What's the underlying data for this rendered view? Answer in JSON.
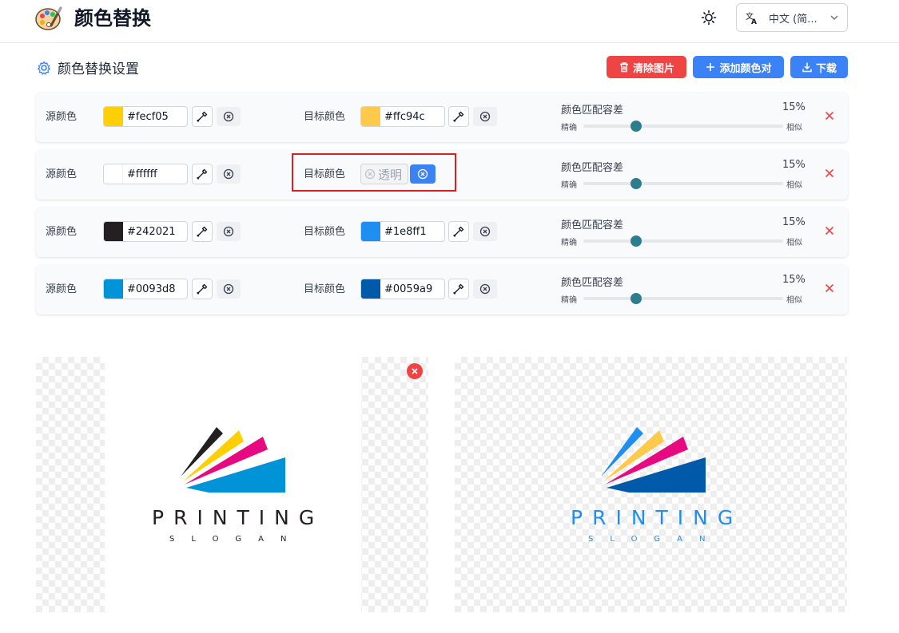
{
  "app": {
    "title": "颜色替换",
    "language": "中文 (简..."
  },
  "settings": {
    "title": "颜色替换设置",
    "clear_label": "清除图片",
    "add_label": "添加颜色对",
    "download_label": "下载"
  },
  "labels": {
    "source": "源颜色",
    "target": "目标颜色",
    "tolerance": "颜色匹配容差",
    "precise": "精确",
    "similar": "相似",
    "transparent": "透明"
  },
  "rows": [
    {
      "source_hex": "#fecf05",
      "target_hex": "#ffc94c",
      "target_transparent": false,
      "tolerance_text": "15%",
      "tolerance": 15
    },
    {
      "source_hex": "#ffffff",
      "target_hex": "",
      "target_transparent": true,
      "tolerance_text": "15%",
      "tolerance": 15
    },
    {
      "source_hex": "#242021",
      "target_hex": "#1e8ff1",
      "target_transparent": false,
      "tolerance_text": "15%",
      "tolerance": 15
    },
    {
      "source_hex": "#0093d8",
      "target_hex": "#0059a9",
      "target_transparent": false,
      "tolerance_text": "15%",
      "tolerance": 15
    }
  ],
  "original_logo": {
    "word": "PRINTING",
    "slogan": "SLOGAN"
  },
  "result_logo": {
    "word": "PRINTING",
    "slogan": "SLOGAN"
  },
  "colors": {
    "accent": "#3b82f6",
    "danger": "#ef4444",
    "thumb": "#2e7d8c",
    "highlight": "#e11d1d"
  }
}
